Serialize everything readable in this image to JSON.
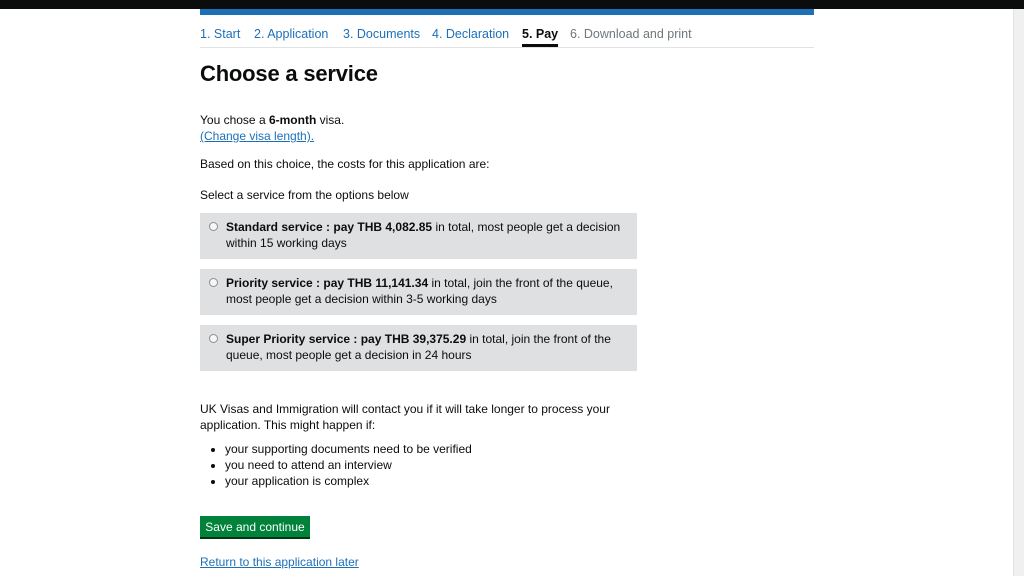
{
  "progress": {
    "steps": [
      {
        "label": "1. Start",
        "state": "done"
      },
      {
        "label": "2. Application",
        "state": "done"
      },
      {
        "label": "3. Documents",
        "state": "done"
      },
      {
        "label": "4. Declaration",
        "state": "done"
      },
      {
        "label": "5. Pay",
        "state": "current"
      },
      {
        "label": "6. Download and print",
        "state": "upcoming"
      }
    ]
  },
  "page": {
    "title": "Choose a service",
    "chosen_prefix": "You chose a ",
    "chosen_value": "6-month",
    "chosen_suffix": " visa.",
    "change_link": "(Change visa length).",
    "costs_intro": "Based on this choice, the costs for this application are:",
    "select_prompt": "Select a service from the options below"
  },
  "options": [
    {
      "bold": "Standard service : pay THB 4,082.85",
      "rest": " in total, most people get a decision within 15 working days",
      "selected": false
    },
    {
      "bold": "Priority service : pay THB 11,141.34",
      "rest": " in total, join the front of the queue, most people get a decision within 3-5 working days",
      "selected": false
    },
    {
      "bold": "Super Priority service : pay THB 39,375.29",
      "rest": " in total, join the front of the queue, most people get a decision in 24 hours",
      "selected": false
    }
  ],
  "notice": {
    "text": "UK Visas and Immigration will contact you if it will take longer to process your application. This might happen if:",
    "reasons": [
      "your supporting documents need to be verified",
      "you need to attend an interview",
      "your application is complex"
    ]
  },
  "actions": {
    "save_label": "Save and continue",
    "return_link": "Return to this application later"
  },
  "colors": {
    "link": "#1d70b8",
    "button": "#00823b",
    "option_bg": "#dee0e2",
    "header_bar": "#1d70b8"
  }
}
